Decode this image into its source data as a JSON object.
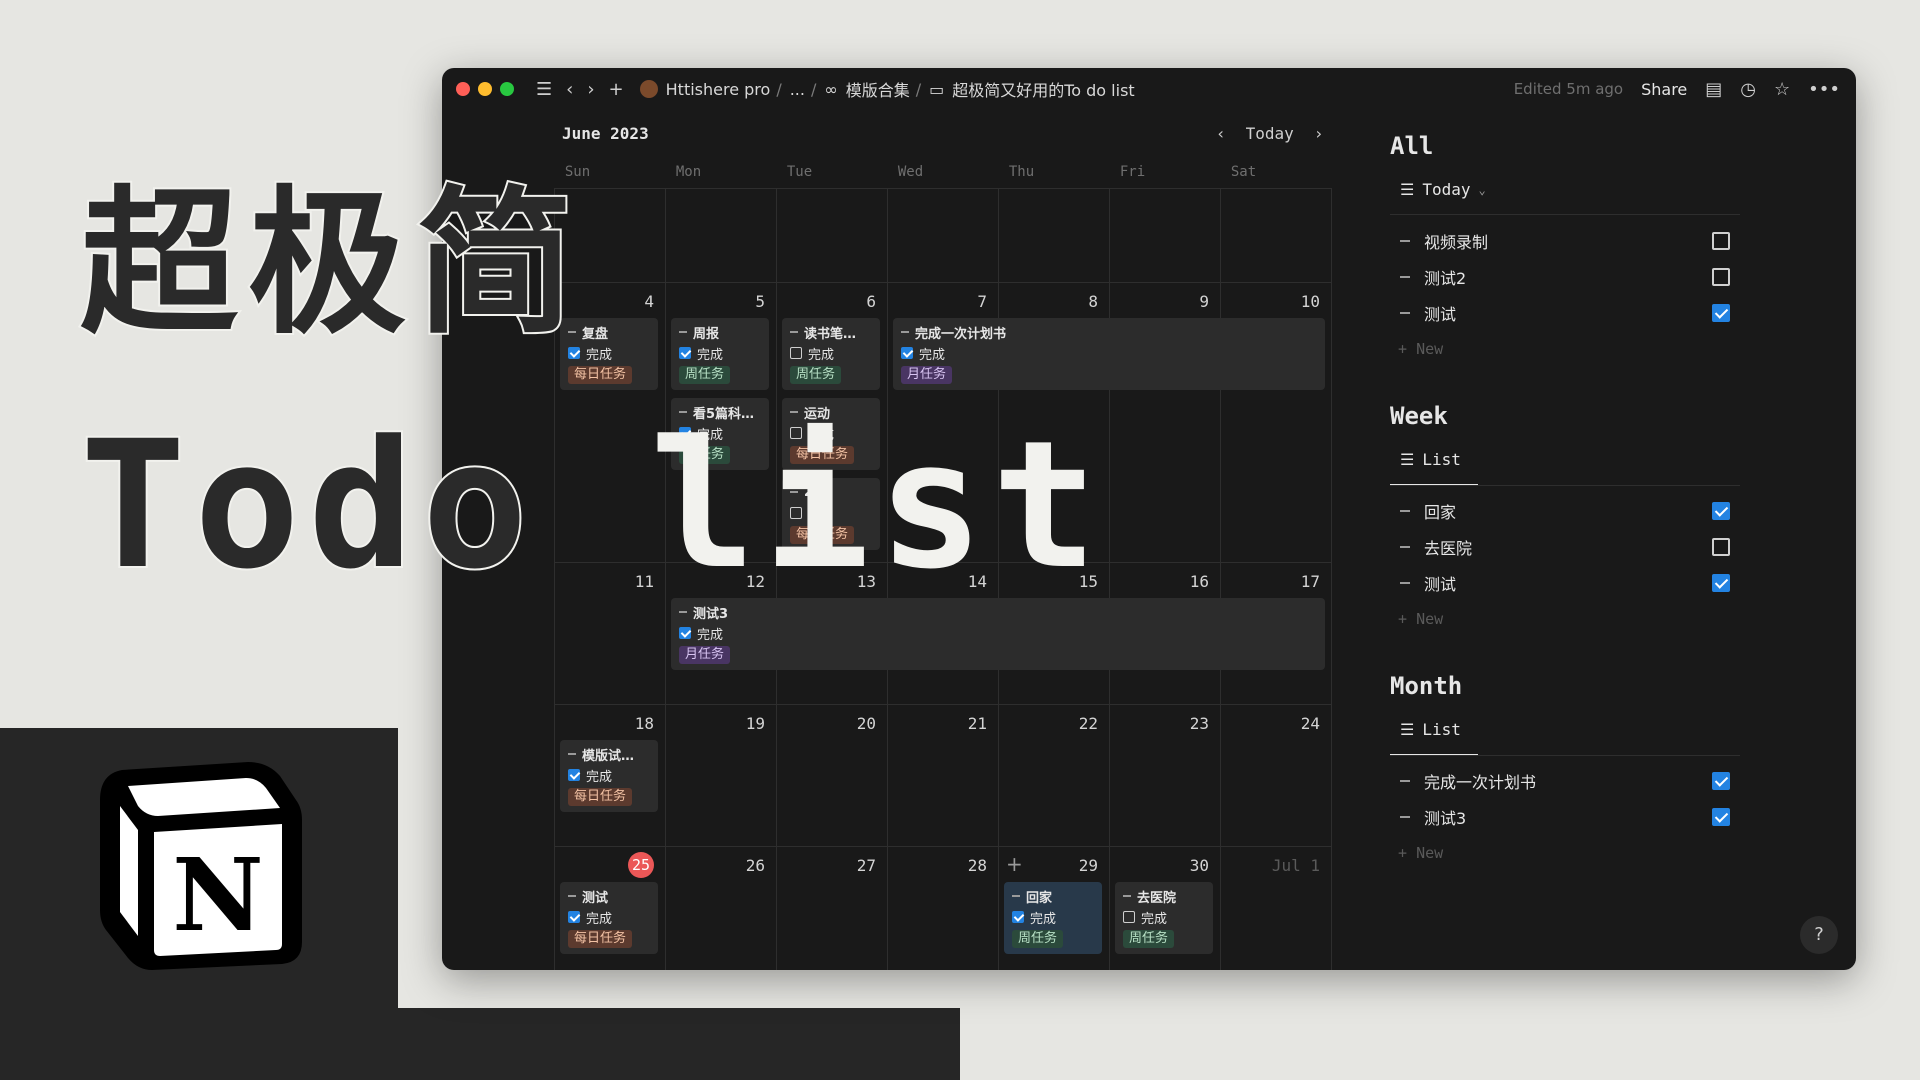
{
  "overlay": {
    "line1": "超极简",
    "line2a": "Todo",
    "line2b": "list"
  },
  "titlebar": {
    "workspace": "Httishere pro",
    "ellipsis": "...",
    "templates": "模版合集",
    "page": "超极简又好用的To do list",
    "edited": "Edited 5m ago",
    "share": "Share"
  },
  "calendar": {
    "month": "June 2023",
    "today_btn": "Today",
    "weekdays": [
      "Sun",
      "Mon",
      "Tue",
      "Wed",
      "Thu",
      "Fri",
      "Sat"
    ],
    "days": {
      "d4": "4",
      "d5": "5",
      "d6": "6",
      "d7": "7",
      "d8": "8",
      "d9": "9",
      "d10": "10",
      "d11": "11",
      "d12": "12",
      "d13": "13",
      "d14": "14",
      "d15": "15",
      "d16": "16",
      "d17": "17",
      "d18": "18",
      "d19": "19",
      "d20": "20",
      "d21": "21",
      "d22": "22",
      "d23": "23",
      "d24": "24",
      "d25": "25",
      "d26": "26",
      "d27": "27",
      "d28": "28",
      "d29": "29",
      "d30": "30",
      "jul1": "Jul 1"
    },
    "done_label": "完成",
    "tags": {
      "daily": "每日任务",
      "weekly": "周任务",
      "monthly": "月任务"
    },
    "events": {
      "fupan": "复盘",
      "zhoubao": "周报",
      "dushu": "读书笔…",
      "plan": "完成一次计划书",
      "kan5": "看5篇科…",
      "yundong": "运动",
      "e2h": "2h",
      "ceshi3": "测试3",
      "mobanshi": "模版试…",
      "ceshi": "测试",
      "huijia": "回家",
      "quyiyuan": "去医院"
    }
  },
  "panel": {
    "all": {
      "title": "All",
      "view": "Today",
      "items": [
        "视频录制",
        "测试2",
        "测试"
      ],
      "checked": [
        false,
        false,
        true
      ]
    },
    "week": {
      "title": "Week",
      "view": "List",
      "items": [
        "回家",
        "去医院",
        "测试"
      ],
      "checked": [
        true,
        false,
        true
      ]
    },
    "month": {
      "title": "Month",
      "view": "List",
      "items": [
        "完成一次计划书",
        "测试3"
      ],
      "checked": [
        true,
        true
      ]
    },
    "new_label": "New"
  },
  "help": "?",
  "colors": {
    "accent": "#2383e2",
    "today": "#eb5757",
    "window_bg": "#191919",
    "page_bg": "#e6e6e2"
  }
}
